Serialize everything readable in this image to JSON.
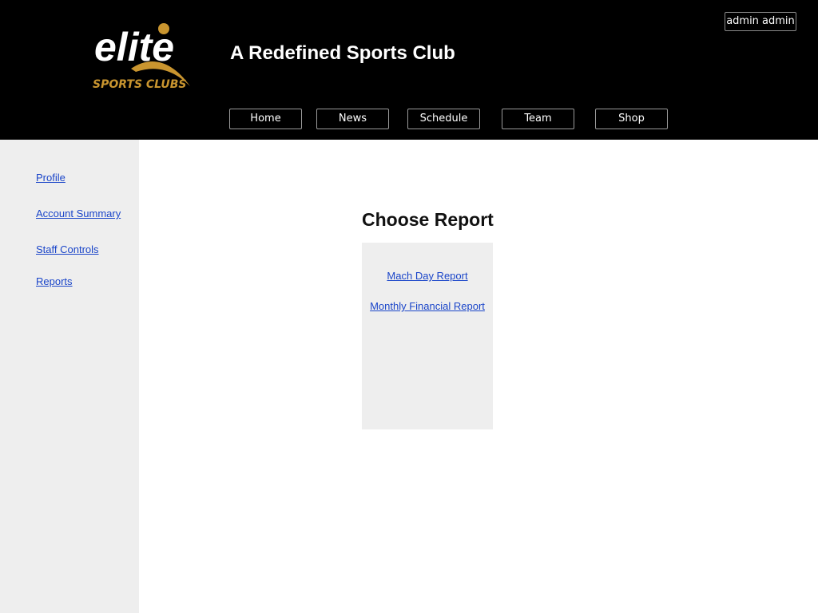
{
  "header": {
    "logo": {
      "word": "elite",
      "tagline": "SPORTS CLUBS",
      "accent_color": "#c9952f"
    },
    "title": "A Redefined Sports Club",
    "user_label": "admin admin",
    "nav": [
      {
        "label": "Home"
      },
      {
        "label": "News"
      },
      {
        "label": "Schedule"
      },
      {
        "label": "Team"
      },
      {
        "label": "Shop"
      }
    ]
  },
  "sidebar": {
    "items": [
      {
        "label": "Profile"
      },
      {
        "label": "Account Summary"
      },
      {
        "label": "Staff Controls"
      },
      {
        "label": "Reports"
      }
    ]
  },
  "main": {
    "title": "Choose Report",
    "reports": [
      {
        "label": "Mach Day Report"
      },
      {
        "label": "Monthly Financial Report"
      }
    ]
  },
  "colors": {
    "header_bg": "#000000",
    "sidebar_bg": "#eeeeee",
    "link": "#1a45c9"
  }
}
